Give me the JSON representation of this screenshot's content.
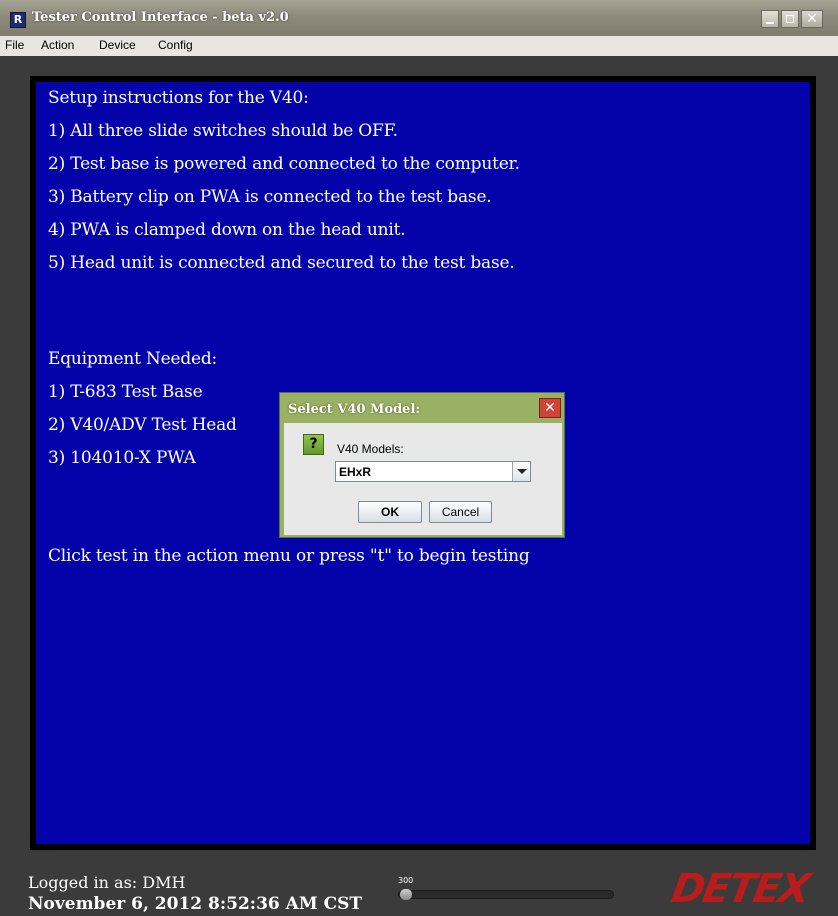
{
  "window": {
    "title": "Tester Control Interface - beta v2.0",
    "app_icon_glyph": "R"
  },
  "menu": [
    "File",
    "Action",
    "Device",
    "Config"
  ],
  "instructions": {
    "setup_heading": "Setup instructions for the V40:",
    "setup_steps": [
      "1) All three slide switches should be OFF.",
      "2) Test base is powered and connected to the computer.",
      "3) Battery clip on PWA is connected to the test base.",
      "4) PWA is clamped down on the head unit.",
      "5) Head unit is connected and secured to the test base."
    ],
    "equipment_heading": "Equipment Needed:",
    "equipment_items": [
      "1) T-683 Test Base",
      "2) V40/ADV Test Head",
      "3) 104010-X PWA"
    ],
    "footer_prompt": "Click test in the action menu or press \"t\" to begin testing"
  },
  "dialog": {
    "title": "Select V40 Model:",
    "icon_glyph": "?",
    "label": "V40 Models:",
    "selected": "EHxR",
    "ok_label": "OK",
    "cancel_label": "Cancel",
    "close_glyph": "✕"
  },
  "status": {
    "logged_in": "Logged in as: DMH",
    "datetime": "November 6, 2012   8:52:36 AM CST",
    "slider_label": "300"
  },
  "logo": "DETEX",
  "colors": {
    "panel_bg": "#0303a9",
    "dialog_frame": "#9ab062",
    "logo": "#ba1c1c"
  }
}
